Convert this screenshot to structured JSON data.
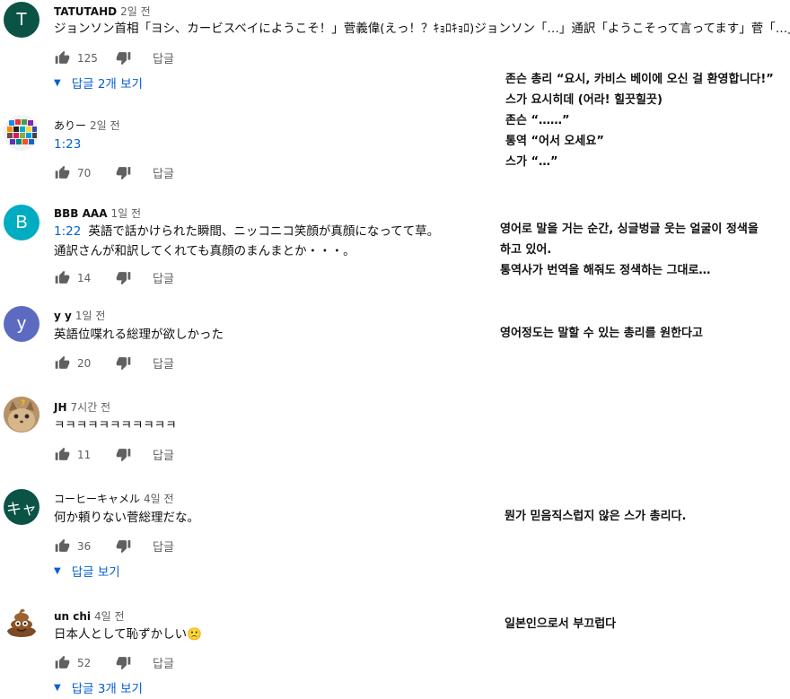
{
  "comments": [
    {
      "author": "TATUTAHD",
      "time": "2일 전",
      "avatar_letter": "T",
      "avatar_color": "#0b5345",
      "text": "ジョンソン首相「ヨシ、カービスベイにようこそ！」菅義偉(えっ！？ｷｮﾛｷｮﾛ)ジョンソン「…」通訳「ようこそって言ってます」菅「…」",
      "likes": "125",
      "reply_label": "답글",
      "view_replies": "답글 2개 보기",
      "translation": [
        "존슨 총리 “요시, 카비스 베이에 오신 걸 환영합니다!”",
        "스가 요시히데 (어라! 힐끗힐끗)",
        "존슨 “……”",
        "통역 “어서 오세요”",
        "스가 “…”"
      ]
    },
    {
      "author": "ありー",
      "time": "2일 전",
      "timestamp": "1:23",
      "text": "",
      "likes": "70",
      "reply_label": "답글"
    },
    {
      "author": "BBB AAA",
      "time": "1일 전",
      "avatar_letter": "B",
      "avatar_color": "#00acc1",
      "timestamp": "1:22",
      "text": "英語で話かけられた瞬間、ニッコニコ笑顔が真顔になってて草。",
      "text2": "通訳さんが和訳してくれても真顔のまんまとか・・・。",
      "likes": "14",
      "reply_label": "답글",
      "translation": [
        "영어로 말을 거는 순간, 싱글벙글 웃는 얼굴이 정색을",
        "하고 있어.",
        "통역사가 번역을 해줘도 정색하는 그대로…"
      ]
    },
    {
      "author": "y y",
      "time": "1일 전",
      "avatar_letter": "y",
      "avatar_color": "#5c6bc0",
      "text": "英語位喋れる総理が欲しかった",
      "likes": "20",
      "reply_label": "답글",
      "translation": [
        "영어정도는 말할 수 있는 총리를 원한다고"
      ]
    },
    {
      "author": "JH",
      "time": "7시간 전",
      "text": "ㅋㅋㅋㅋㅋㅋㅋㅋㅋㅋㅋ",
      "likes": "11",
      "reply_label": "답글"
    },
    {
      "author": "コーヒーキャメル",
      "time": "4일 전",
      "avatar_letter": "キャ",
      "avatar_color": "#0b5345",
      "text": "何か頼りない菅総理だな。",
      "likes": "36",
      "reply_label": "답글",
      "view_replies": "답글 보기",
      "translation": [
        "뭔가 믿음직스럽지 않은 스가 총리다."
      ]
    },
    {
      "author": "un chi",
      "time": "4일 전",
      "text": "日本人として恥ずかしい",
      "emoji": "🙁",
      "likes": "52",
      "reply_label": "답글",
      "view_replies": "답글 3개 보기",
      "translation": [
        "일본인으로서 부끄럽다"
      ]
    }
  ],
  "icons": {
    "like": "thumb-up-icon",
    "dislike": "thumb-down-icon",
    "expand": "caret-down-icon"
  },
  "colors": {
    "link_blue": "#065fd4",
    "meta_gray": "#606060"
  }
}
